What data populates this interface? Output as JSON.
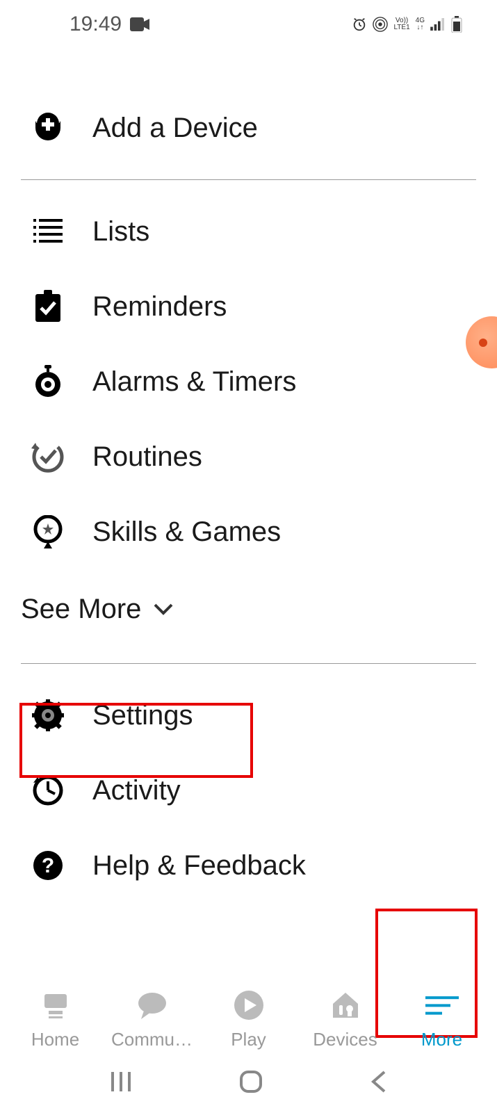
{
  "status": {
    "time": "19:49"
  },
  "menu": {
    "add_device": "Add a Device",
    "lists": "Lists",
    "reminders": "Reminders",
    "alarms": "Alarms & Timers",
    "routines": "Routines",
    "skills": "Skills & Games",
    "see_more": "See More",
    "settings": "Settings",
    "activity": "Activity",
    "help": "Help & Feedback"
  },
  "nav": {
    "home": "Home",
    "communicate": "Commu…",
    "play": "Play",
    "devices": "Devices",
    "more": "More"
  }
}
